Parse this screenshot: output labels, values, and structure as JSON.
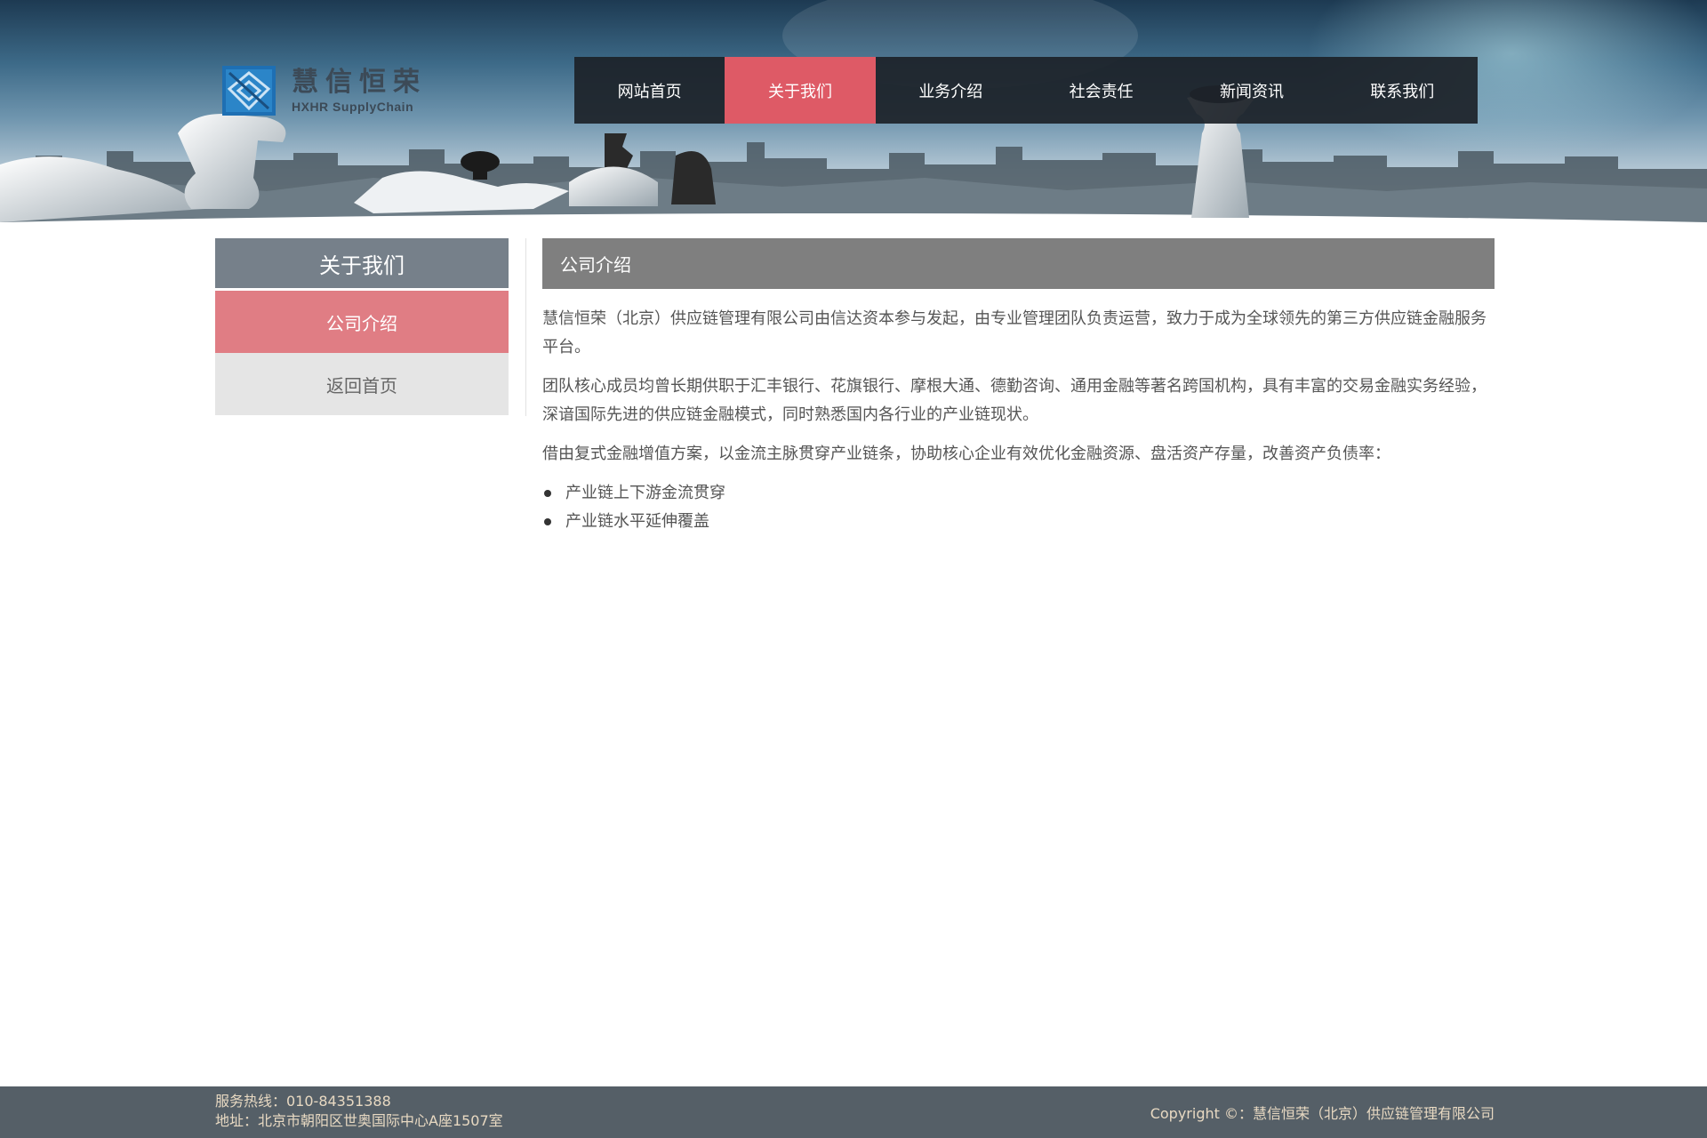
{
  "logo": {
    "name_cn": "慧信恒荣",
    "name_en": "HXHR SupplyChain"
  },
  "nav": {
    "items": [
      {
        "label": "网站首页"
      },
      {
        "label": "关于我们"
      },
      {
        "label": "业务介绍"
      },
      {
        "label": "社会责任"
      },
      {
        "label": "新闻资讯"
      },
      {
        "label": "联系我们"
      }
    ],
    "active": "关于我们"
  },
  "sidebar": {
    "title": "关于我们",
    "items": [
      {
        "label": "公司介绍"
      },
      {
        "label": "返回首页"
      }
    ],
    "active": "公司介绍"
  },
  "content": {
    "title": "公司介绍",
    "paragraphs": [
      "慧信恒荣（北京）供应链管理有限公司由信达资本参与发起，由专业管理团队负责运营，致力于成为全球领先的第三方供应链金融服务平台。",
      "团队核心成员均曾长期供职于汇丰银行、花旗银行、摩根大通、德勤咨询、通用金融等著名跨国机构，具有丰富的交易金融实务经验，深谙国际先进的供应链金融模式，同时熟悉国内各行业的产业链现状。",
      "借由复式金融增值方案，以金流主脉贯穿产业链条，协助核心企业有效优化金融资源、盘活资产存量，改善资产负债率："
    ],
    "bullets": [
      "产业链上下游金流贯穿",
      "产业链水平延伸覆盖"
    ]
  },
  "footer": {
    "hotline": "服务热线：010-84351388",
    "address": "地址：北京市朝阳区世奥国际中心A座1507室",
    "copyright": "Copyright ©：慧信恒荣（北京）供应链管理有限公司"
  },
  "colors": {
    "nav_bg": "#1c2228",
    "accent": "#de5a66",
    "sidebar_title_bg": "#76808a",
    "sidebar_active_bg": "#e07d84",
    "content_header_bg": "#7f7f7f",
    "footer_bg": "#555f67"
  },
  "icons": {
    "logo": "hxhr-logo-icon",
    "bullet": "bullet-dot-icon"
  }
}
